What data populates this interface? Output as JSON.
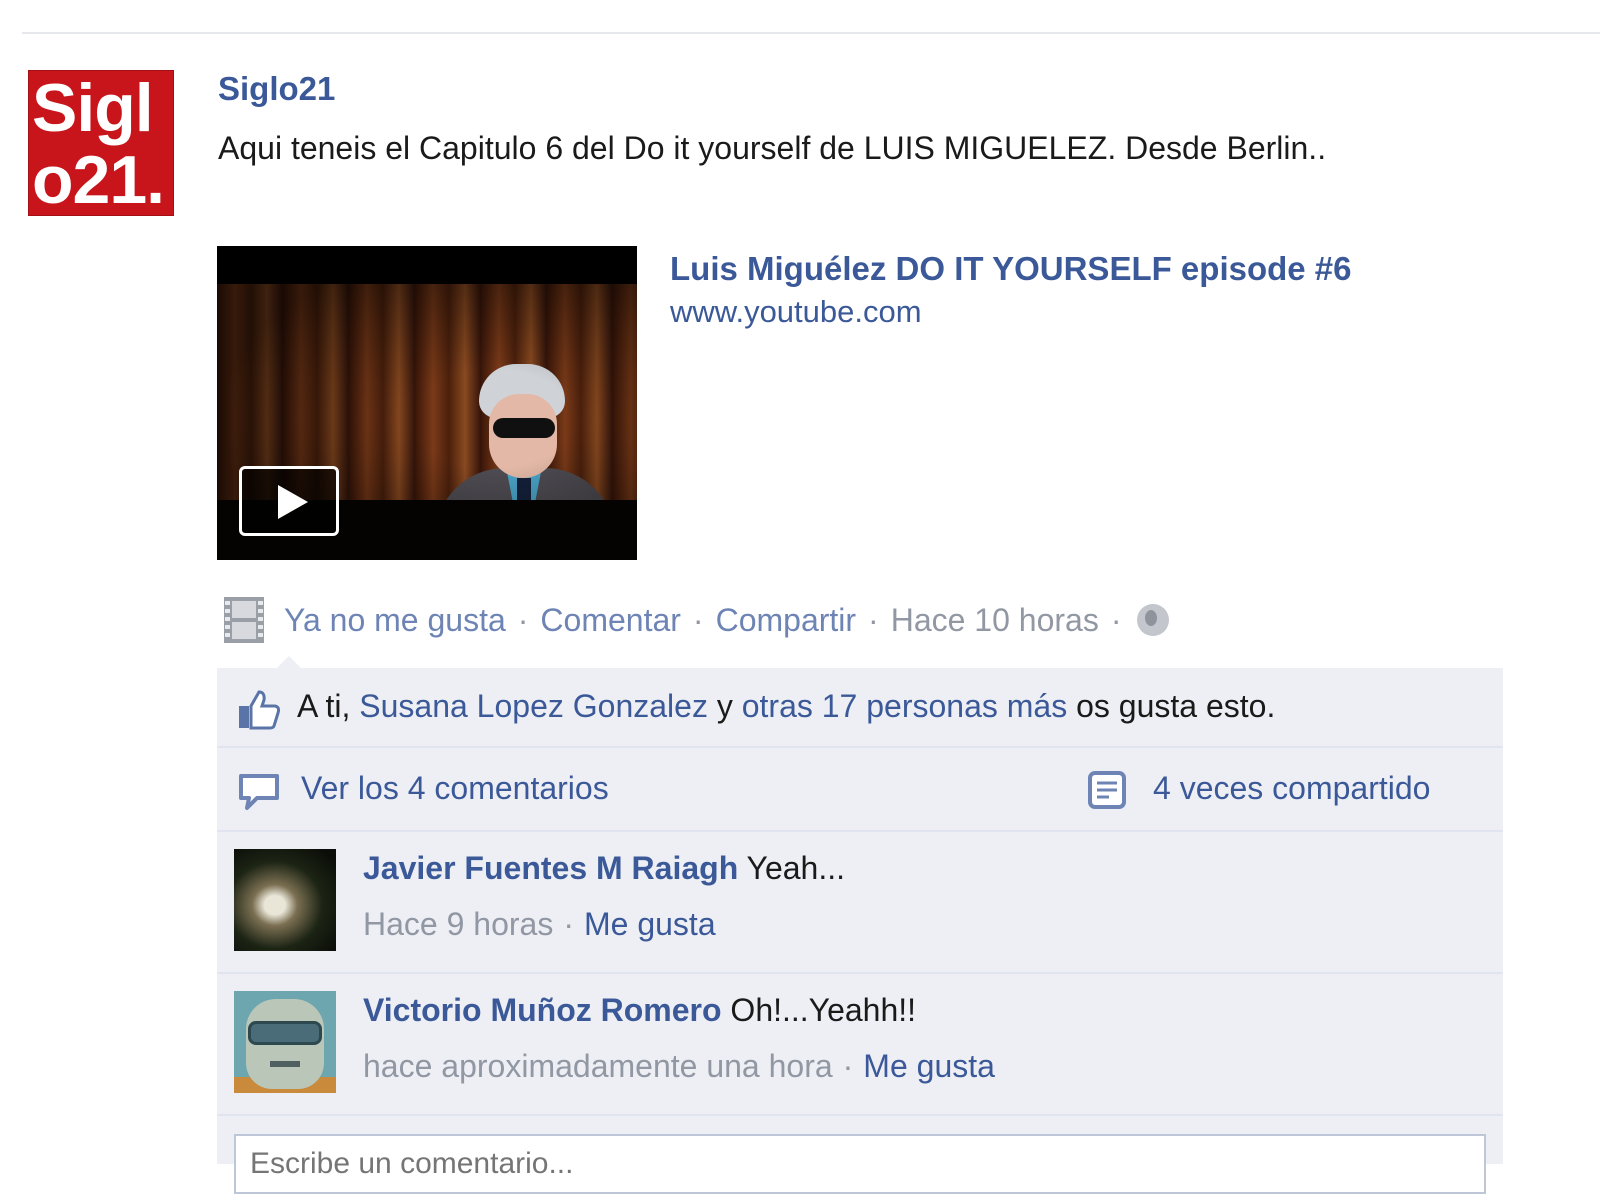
{
  "post": {
    "author": "Siglo21",
    "avatar_text_line1": "Sigl",
    "avatar_text_line2": "o21.",
    "message": "Aqui teneis el Capitulo 6 del Do it yourself de LUIS MIGUELEZ. Desde Berlin.."
  },
  "attachment": {
    "title": "Luis Miguélez DO IT YOURSELF episode #6",
    "domain": "www.youtube.com",
    "play_icon": "play-icon"
  },
  "actions": {
    "unlike": "Ya no me gusta",
    "comment": "Comentar",
    "share": "Compartir",
    "separator": "·",
    "time": "Hace 10 horas",
    "type_icon": "film-icon",
    "privacy_icon": "globe-icon"
  },
  "likes": {
    "prefix": "A ti,",
    "friend": "Susana Lopez Gonzalez",
    "conj": "y",
    "others": "otras 17 personas más",
    "suffix": "os gusta esto."
  },
  "comments_bar": {
    "view_all": "Ver los 4 comentarios",
    "shares": "4 veces compartido"
  },
  "comments": [
    {
      "name": "Javier Fuentes M Raiagh",
      "text": "Yeah...",
      "time": "Hace 9 horas",
      "like": "Me gusta"
    },
    {
      "name": "Victorio Muñoz Romero",
      "text": "Oh!...Yeahh!!",
      "time": "hace aproximadamente una hora",
      "like": "Me gusta"
    }
  ],
  "comment_input": {
    "placeholder": "Escribe un comentario..."
  },
  "colors": {
    "link": "#3b5998",
    "muted": "#9197a3",
    "ufi_bg": "#edeff4",
    "brand_red": "#c8151b"
  }
}
